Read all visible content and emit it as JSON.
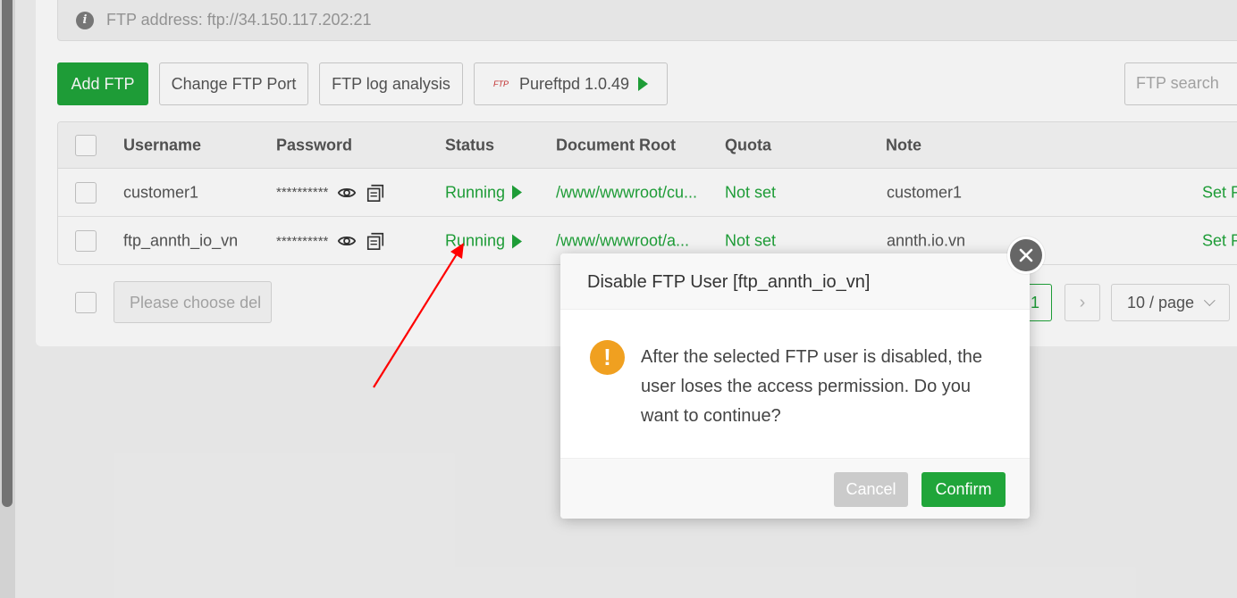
{
  "info_bar": {
    "icon": "info-icon",
    "text": "FTP address: ftp://34.150.117.202:21"
  },
  "toolbar": {
    "add_ftp": "Add FTP",
    "change_port": "Change FTP Port",
    "log_analysis": "FTP log analysis",
    "pureftpd_logo": "FTP",
    "pureftpd": "Pureftpd 1.0.49",
    "search_placeholder": "FTP search"
  },
  "table": {
    "headers": {
      "username": "Username",
      "password": "Password",
      "status": "Status",
      "document_root": "Document Root",
      "quota": "Quota",
      "note": "Note"
    },
    "rows": [
      {
        "username": "customer1",
        "password": "**********",
        "status": "Running",
        "document_root": "/www/wwwroot/cu...",
        "quota": "Not set",
        "note": "customer1",
        "action": "Set P"
      },
      {
        "username": "ftp_annth_io_vn",
        "password": "**********",
        "status": "Running",
        "document_root": "/www/wwwroot/a...",
        "quota": "Not set",
        "note": "annth.io.vn",
        "action": "Set P"
      }
    ]
  },
  "footer": {
    "delete_placeholder": "Please choose del",
    "page_number": "1",
    "page_size": "10 / page"
  },
  "modal": {
    "title": "Disable FTP User [ftp_annth_io_vn]",
    "message": "After the selected FTP user is disabled, the user loses the access permission. Do you want to continue?",
    "cancel": "Cancel",
    "confirm": "Confirm",
    "icon": "warning-icon",
    "warning_glyph": "!"
  },
  "colors": {
    "primary": "#20a53a",
    "warning": "#f0a020",
    "annotation_arrow": "#ff0000"
  }
}
